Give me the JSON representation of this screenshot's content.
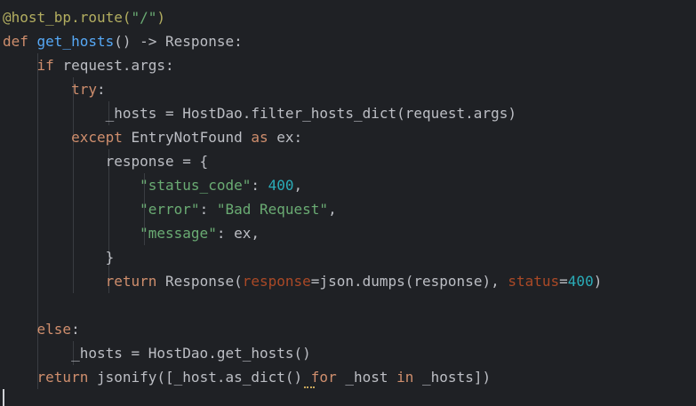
{
  "colors": {
    "background": "#1f2125",
    "text": "#bcbec4",
    "keyword": "#cf8e6d",
    "function": "#56a8f5",
    "string": "#6aab73",
    "number": "#2aacb8",
    "decorator": "#b3ae60",
    "param": "#c77dbb",
    "kwarg": "#aa4926"
  },
  "code_lines": [
    {
      "tokens": [
        {
          "text": "@host_bp.route(",
          "c": "decorator"
        },
        {
          "text": "\"/\"",
          "c": "string"
        },
        {
          "text": ")",
          "c": "decorator"
        }
      ]
    },
    {
      "tokens": [
        {
          "text": "def ",
          "c": "keyword"
        },
        {
          "text": "get_hosts",
          "c": "function"
        },
        {
          "text": "() -> Response:",
          "c": "text"
        }
      ]
    },
    {
      "tokens": [
        {
          "text": "    ",
          "c": "text"
        },
        {
          "text": "if ",
          "c": "keyword"
        },
        {
          "text": "request.args:",
          "c": "text"
        }
      ]
    },
    {
      "tokens": [
        {
          "text": "        ",
          "c": "text"
        },
        {
          "text": "try",
          "c": "keyword"
        },
        {
          "text": ":",
          "c": "text"
        }
      ]
    },
    {
      "tokens": [
        {
          "text": "            _hosts = HostDao.filter_hosts_dict(request.args)",
          "c": "text"
        }
      ]
    },
    {
      "tokens": [
        {
          "text": "        ",
          "c": "text"
        },
        {
          "text": "except ",
          "c": "keyword"
        },
        {
          "text": "EntryNotFound ",
          "c": "text"
        },
        {
          "text": "as ",
          "c": "keyword"
        },
        {
          "text": "ex:",
          "c": "text"
        }
      ]
    },
    {
      "tokens": [
        {
          "text": "            response = {",
          "c": "text"
        }
      ]
    },
    {
      "tokens": [
        {
          "text": "                ",
          "c": "text"
        },
        {
          "text": "\"status_code\"",
          "c": "string"
        },
        {
          "text": ": ",
          "c": "text"
        },
        {
          "text": "400",
          "c": "number"
        },
        {
          "text": ",",
          "c": "text"
        }
      ]
    },
    {
      "tokens": [
        {
          "text": "                ",
          "c": "text"
        },
        {
          "text": "\"error\"",
          "c": "string"
        },
        {
          "text": ": ",
          "c": "text"
        },
        {
          "text": "\"Bad Request\"",
          "c": "string"
        },
        {
          "text": ",",
          "c": "text"
        }
      ]
    },
    {
      "tokens": [
        {
          "text": "                ",
          "c": "text"
        },
        {
          "text": "\"message\"",
          "c": "string"
        },
        {
          "text": ": ex,",
          "c": "text"
        }
      ]
    },
    {
      "tokens": [
        {
          "text": "            }",
          "c": "text"
        }
      ]
    },
    {
      "tokens": [
        {
          "text": "            ",
          "c": "text"
        },
        {
          "text": "return ",
          "c": "keyword"
        },
        {
          "text": "Response(",
          "c": "text"
        },
        {
          "text": "response",
          "c": "kwarg"
        },
        {
          "text": "=json.dumps(response), ",
          "c": "text"
        },
        {
          "text": "status",
          "c": "kwarg"
        },
        {
          "text": "=",
          "c": "text"
        },
        {
          "text": "400",
          "c": "number"
        },
        {
          "text": ")",
          "c": "text"
        }
      ]
    },
    {
      "tokens": []
    },
    {
      "tokens": [
        {
          "text": "    ",
          "c": "text"
        },
        {
          "text": "else",
          "c": "keyword"
        },
        {
          "text": ":",
          "c": "text"
        }
      ]
    },
    {
      "tokens": [
        {
          "text": "        _hosts = HostDao.get_hosts()",
          "c": "text"
        }
      ]
    },
    {
      "tokens": [
        {
          "text": "    ",
          "c": "text"
        },
        {
          "text": "return ",
          "c": "keyword"
        },
        {
          "text": "jsonify([_host.as_dict() ",
          "c": "text"
        },
        {
          "text": "for ",
          "c": "keyword"
        },
        {
          "text": "_host ",
          "c": "text"
        },
        {
          "text": "in ",
          "c": "keyword"
        },
        {
          "text": "_hosts])",
          "c": "text"
        }
      ]
    },
    {
      "tokens": []
    }
  ]
}
